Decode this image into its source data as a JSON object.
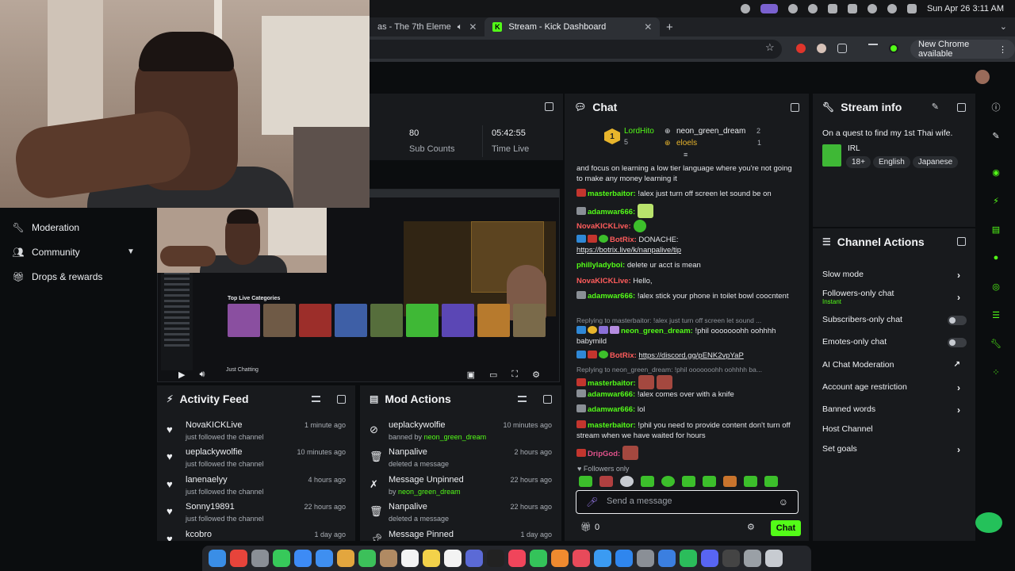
{
  "menubar": {
    "datetime": "Sun Apr 26  3:11 AM"
  },
  "browser": {
    "tabs": [
      {
        "label": "as - The 7th Eleme"
      },
      {
        "label": "Stream - Kick Dashboard"
      }
    ],
    "new_chrome": "New Chrome available"
  },
  "stats": [
    {
      "value": "80",
      "label": "Sub Counts"
    },
    {
      "value": "05:42:55",
      "label": "Time Live"
    }
  ],
  "nav": {
    "items": [
      {
        "label": "Moderation"
      },
      {
        "label": "Community"
      },
      {
        "label": "Drops & rewards"
      }
    ]
  },
  "preview": {
    "section_title": "Top Live Categories",
    "caption": "Just Chatting"
  },
  "activity": {
    "title": "Activity Feed",
    "items": [
      {
        "user": "NovaKICKLive",
        "action": "just followed the channel",
        "time": "1 minute ago"
      },
      {
        "user": "ueplackywolfie",
        "action": "just followed the channel",
        "time": "10 minutes ago"
      },
      {
        "user": "lanenaelyy",
        "action": "just followed the channel",
        "time": "4 hours ago"
      },
      {
        "user": "Sonny19891",
        "action": "just followed the channel",
        "time": "22 hours ago"
      },
      {
        "user": "kcobro",
        "action": "",
        "time": "1 day ago"
      }
    ]
  },
  "mod": {
    "title": "Mod Actions",
    "items": [
      {
        "title": "ueplackywolfie",
        "prefix": "banned by",
        "by": "neon_green_dream",
        "time": "10 minutes ago"
      },
      {
        "title": "Nanpalive",
        "prefix": "deleted a message",
        "by": "",
        "time": "2 hours ago"
      },
      {
        "title": "Message Unpinned",
        "prefix": "by",
        "by": "neon_green_dream",
        "time": "22 hours ago"
      },
      {
        "title": "Nanpalive",
        "prefix": "deleted a message",
        "by": "",
        "time": "22 hours ago"
      },
      {
        "title": "Message Pinned",
        "prefix": "",
        "by": "",
        "time": "1 day ago"
      }
    ]
  },
  "chat": {
    "title": "Chat",
    "leaders": [
      {
        "rank": "1",
        "name": "LordHito",
        "count": "5"
      },
      {
        "name": "neon_green_dream",
        "count": "2"
      },
      {
        "name": "eloels",
        "count": "1"
      }
    ],
    "messages": [
      {
        "user": "",
        "text": "and focus on learning a low tier language where you're not going to make any money learning it"
      },
      {
        "user": "masterbaitor:",
        "text": "!alex just turn off screen let sound be on"
      },
      {
        "user": "adamwar666:",
        "text": ""
      },
      {
        "user": "NovaKICKLive:",
        "text": ""
      },
      {
        "user": "BotRix:",
        "text": "DONACHE:",
        "link": "https://botrix.live/k/nanpalive/tip"
      },
      {
        "user": "phillyladyboi:",
        "text": "delete ur acct is mean"
      },
      {
        "user": "NovaKICKLive:",
        "text": "Hello,"
      },
      {
        "user": "adamwar666:",
        "text": "!alex stick your phone in toilet bowl coocntent"
      },
      {
        "reply": "Replying to masterbaitor: !alex just turn off screen let sound ...",
        "user": "neon_green_dream:",
        "text": "!phil ooooooohh oohhhh babymild"
      },
      {
        "user": "BotRix:",
        "link": "https://discord.gg/pENK2vpYaP"
      },
      {
        "reply": "Replying to neon_green_dream: !phil ooooooohh oohhhh ba...",
        "user": "masterbaitor:",
        "text": ""
      },
      {
        "user": "adamwar666:",
        "text": "!alex comes over with a knife"
      },
      {
        "user": "adamwar666:",
        "text": "lol"
      },
      {
        "user": "masterbaitor:",
        "text": "!phil you need to provide content don't turn off stream when we have waited for hours"
      },
      {
        "user": "DripGod:",
        "text": ""
      }
    ],
    "followers_only": "Followers only",
    "input_placeholder": "Send a message",
    "count": "0",
    "send_label": "Chat"
  },
  "stream_info": {
    "title": "Stream info",
    "stream_title": "On a quest to find my 1st Thai wife.",
    "category": "IRL",
    "tags": [
      "18+",
      "English",
      "Japanese"
    ]
  },
  "channel_actions": {
    "title": "Channel Actions",
    "items": [
      {
        "label": "Slow mode",
        "control": "chevron"
      },
      {
        "label": "Followers-only chat",
        "sub": "Instant",
        "control": "chevron"
      },
      {
        "label": "Subscribers-only chat",
        "control": "toggle",
        "on": false
      },
      {
        "label": "Emotes-only chat",
        "control": "toggle",
        "on": false
      },
      {
        "label": "AI Chat Moderation",
        "control": "external"
      },
      {
        "label": "Account age restriction",
        "control": "chevron"
      },
      {
        "label": "Banned words",
        "control": "chevron"
      },
      {
        "label": "Host Channel",
        "control": "none"
      },
      {
        "label": "Set goals",
        "control": "chevron"
      }
    ]
  },
  "colors": {
    "accent": "#53fc18",
    "panel": "#181a1d",
    "background": "#0b0d0f"
  }
}
